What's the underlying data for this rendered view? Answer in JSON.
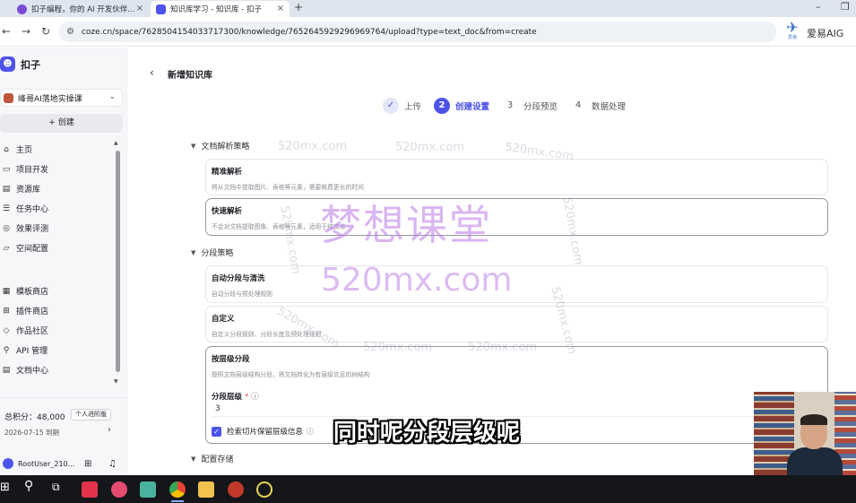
{
  "browser": {
    "tabs": [
      {
        "title": "扣子编程，你的 AI 开发伙伴..."
      },
      {
        "title": "知识库学习 - 知识库 - 扣子"
      }
    ],
    "new_tab": "+",
    "url": "coze.cn/space/7628504154033717300/knowledge/7652645929296969764/upload?type=text_doc&from=create",
    "overlay_logo_text": "爱易",
    "overlay_text": "爱易AIG"
  },
  "sidebar": {
    "brand": "扣子",
    "workspace": "峰哥AI落地实操课",
    "create_label": "+ 创建",
    "nav": [
      {
        "label": "主页",
        "icon": "home-icon",
        "glyph": "⌂"
      },
      {
        "label": "项目开发",
        "icon": "project-icon",
        "glyph": "▭"
      },
      {
        "label": "资源库",
        "icon": "library-icon",
        "glyph": "▤"
      },
      {
        "label": "任务中心",
        "icon": "task-icon",
        "glyph": "☰"
      },
      {
        "label": "效果评测",
        "icon": "eval-icon",
        "glyph": "◎"
      },
      {
        "label": "空间配置",
        "icon": "space-config-icon",
        "glyph": "▱"
      },
      {
        "label": "模板商店",
        "icon": "template-store-icon",
        "glyph": "▦"
      },
      {
        "label": "插件商店",
        "icon": "plugin-store-icon",
        "glyph": "⊞"
      },
      {
        "label": "作品社区",
        "icon": "community-icon",
        "glyph": "◇"
      },
      {
        "label": "API 管理",
        "icon": "api-icon",
        "glyph": "⚲"
      },
      {
        "label": "文档中心",
        "icon": "docs-icon",
        "glyph": "▤"
      }
    ],
    "points_label": "总积分：48,000",
    "plan_badge": "个人进阶版",
    "expiry": "2026-07-15 到期",
    "user": "RootUser_210..."
  },
  "main": {
    "page_title": "新增知识库",
    "steps": [
      {
        "num": "✓",
        "label": "上传",
        "state": "done"
      },
      {
        "num": "2",
        "label": "创建设置",
        "state": "active"
      },
      {
        "num": "3",
        "label": "分段预览",
        "state": "todo"
      },
      {
        "num": "4",
        "label": "数据处理",
        "state": "todo"
      }
    ],
    "parse_section": "文档解析策略",
    "parse_options": [
      {
        "title": "精准解析",
        "desc": "将从文档中提取图片、表格等元素，需要耗费更长的时间"
      },
      {
        "title": "快速解析",
        "desc": "不会对文档提取图像、表格等元素，适用于纯文本"
      }
    ],
    "segment_section": "分段策略",
    "segment_options": [
      {
        "title": "自动分段与清洗",
        "desc": "自动分段与预处理规则"
      },
      {
        "title": "自定义",
        "desc": "自定义分段规则、分段长度及预处理规则"
      },
      {
        "title": "按层级分段",
        "desc": "按照文档层级结构分段，将文档转化为有层级信息的树结构"
      }
    ],
    "level_label": "分段层级",
    "level_required": "*",
    "level_value": "3",
    "checkbox_label": "检索切片保留层级信息",
    "storage_section": "配置存储"
  },
  "watermarks": {
    "big": "梦想课堂",
    "site": "520mx.com",
    "small": "520mx.com"
  },
  "caption": "同时呢分段层级呢"
}
